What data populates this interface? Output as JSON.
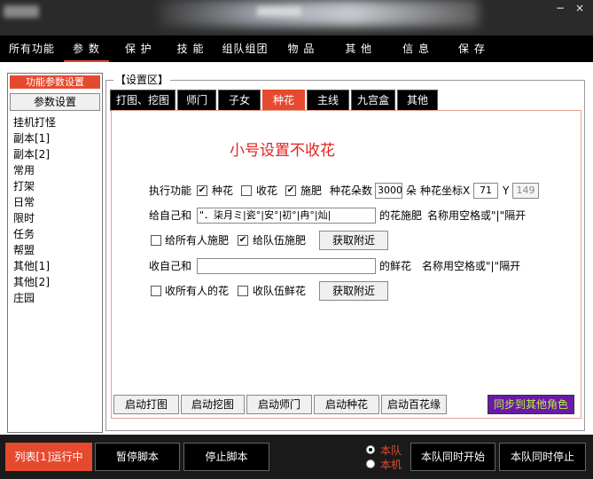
{
  "window": {
    "minimize_glyph": "−",
    "close_glyph": "×"
  },
  "menu": [
    "所有功能",
    "参 数",
    "保 护",
    "技 能",
    "组队组团",
    "物 品",
    "其 他",
    "信 息",
    "保 存"
  ],
  "left_panel": {
    "title": "功能参数设置",
    "button": "参数设置",
    "items": [
      "挂机打怪",
      "副本[1]",
      "副本[2]",
      "常用",
      "打架",
      "日常",
      "限时",
      "任务",
      "帮盟",
      "其他[1]",
      "其他[2]",
      "庄园"
    ]
  },
  "settings": {
    "group_label": "【设置区】",
    "tabs": [
      {
        "label": "打图、挖图",
        "active": false
      },
      {
        "label": "师门",
        "active": false
      },
      {
        "label": "子女",
        "active": false
      },
      {
        "label": "种花",
        "active": true
      },
      {
        "label": "主线",
        "active": false
      },
      {
        "label": "九宫盒",
        "active": false
      },
      {
        "label": "其他",
        "active": false
      }
    ],
    "heading": "小号设置不收花",
    "row1": {
      "label": "执行功能",
      "plant_label": "种花",
      "plant_checked": "✔",
      "collect_label": "收花",
      "collect_checked": "",
      "fert_label": "施肥",
      "fert_checked": "✔",
      "count_label": "种花朵数",
      "count_value": "3000",
      "count_unit": "朵",
      "coord_label": "种花坐标X",
      "x_value": "71",
      "y_label": "Y",
      "y_value": "149"
    },
    "row2": {
      "prefix": "给自己和",
      "names_value": "\"．柒月ミ|瓷°|安°|初°|冉°|灿|",
      "suffix": "的花施肥",
      "hint": "名称用空格或\"|\"隔开"
    },
    "row3": {
      "all_label": "给所有人施肥",
      "all_checked": "",
      "team_label": "给队伍施肥",
      "team_checked": "✔",
      "nearby_button": "获取附近"
    },
    "row4": {
      "prefix": "收自己和",
      "names_value": "",
      "suffix": "的鲜花",
      "hint": "名称用空格或\"|\"隔开"
    },
    "row5": {
      "all_label": "收所有人的花",
      "all_checked": "",
      "team_label": "收队伍鲜花",
      "team_checked": "",
      "nearby_button": "获取附近"
    },
    "action_buttons": [
      "启动打图",
      "启动挖图",
      "启动师门",
      "启动种花",
      "启动百花缘"
    ],
    "sync_button": "同步到其他角色"
  },
  "bottom": {
    "status_button": "列表[1]运行中",
    "pause_button": "暂停脚本",
    "stop_button": "停止脚本",
    "radio_team": "本队",
    "radio_machine": "本机",
    "start_team_button": "本队同时开始",
    "stop_team_button": "本队同时停止"
  },
  "colors": {
    "accent": "#e64a2e",
    "heading_red": "#e62020",
    "sync_bg": "#6a1aa8",
    "sync_text": "#b8f040"
  }
}
